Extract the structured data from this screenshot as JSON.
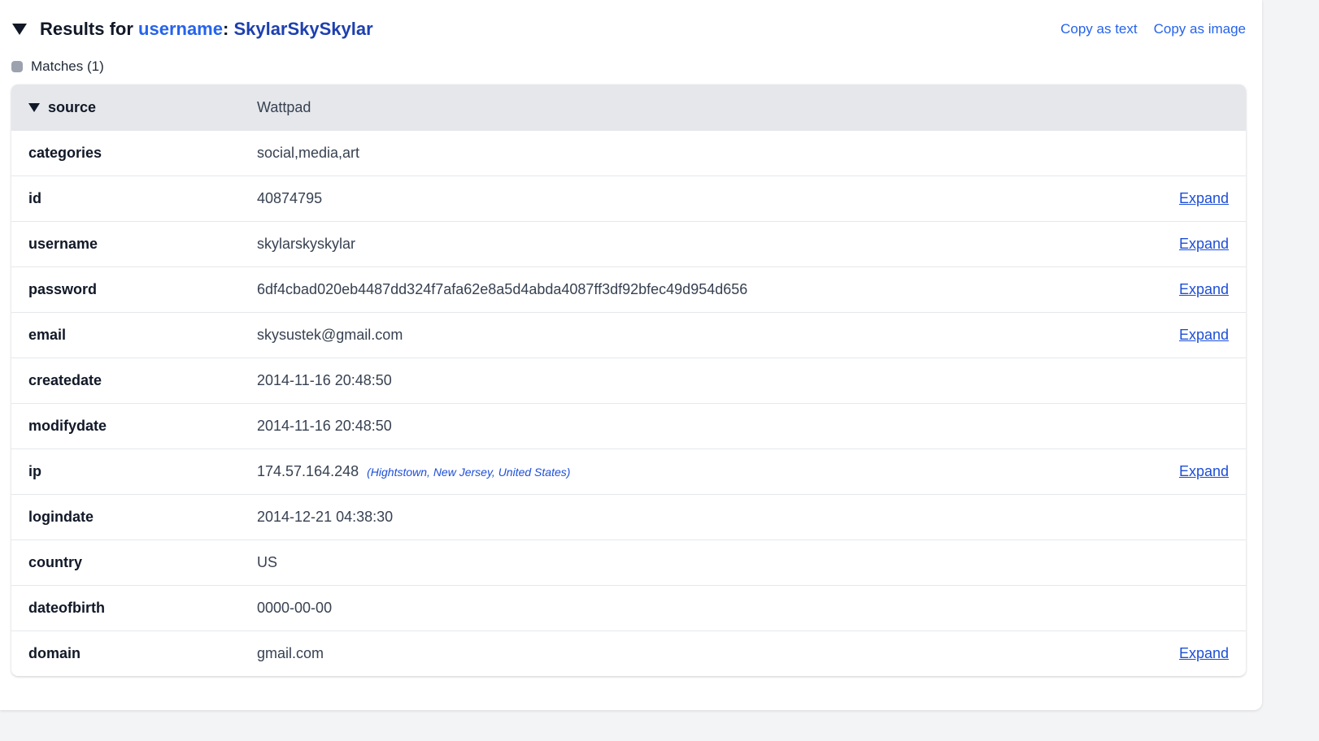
{
  "header": {
    "title_prefix": "Results for ",
    "field": "username",
    "colon": ":",
    "value": "SkylarSkySkylar",
    "copy_text_label": "Copy as text",
    "copy_image_label": "Copy as image"
  },
  "matches": {
    "label": "Matches (1)"
  },
  "source": {
    "key": "source",
    "value": "Wattpad"
  },
  "expand_label": "Expand",
  "fields": [
    {
      "key": "categories",
      "value": "social,media,art",
      "expandable": false
    },
    {
      "key": "id",
      "value": "40874795",
      "expandable": true
    },
    {
      "key": "username",
      "value": "skylarskyskylar",
      "expandable": true
    },
    {
      "key": "password",
      "value": "6df4cbad020eb4487dd324f7afa62e8a5d4abda4087ff3df92bfec49d954d656",
      "expandable": true
    },
    {
      "key": "email",
      "value": "skysustek@gmail.com",
      "expandable": true
    },
    {
      "key": "createdate",
      "value": "2014-11-16 20:48:50",
      "expandable": false
    },
    {
      "key": "modifydate",
      "value": "2014-11-16 20:48:50",
      "expandable": false
    },
    {
      "key": "ip",
      "value": "174.57.164.248",
      "geo": "(Hightstown, New Jersey, United States)",
      "expandable": true
    },
    {
      "key": "logindate",
      "value": "2014-12-21 04:38:30",
      "expandable": false
    },
    {
      "key": "country",
      "value": "US",
      "expandable": false
    },
    {
      "key": "dateofbirth",
      "value": "0000-00-00",
      "expandable": false
    },
    {
      "key": "domain",
      "value": "gmail.com",
      "expandable": true
    }
  ]
}
